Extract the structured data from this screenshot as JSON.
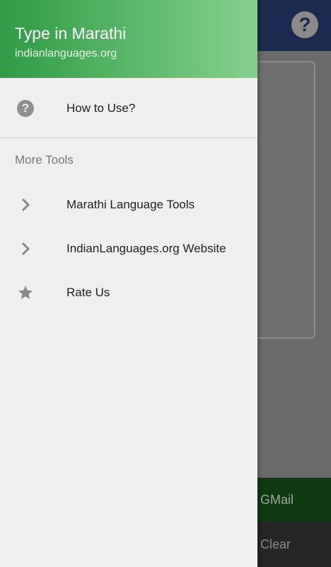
{
  "drawer": {
    "title": "Type in Marathi",
    "subtitle": "indianlanguages.org",
    "items": [
      {
        "label": "How to Use?",
        "icon": "help-icon"
      }
    ],
    "section_header": "More Tools",
    "tools": [
      {
        "label": "Marathi Language Tools",
        "icon": "chevron-right-icon"
      },
      {
        "label": "IndianLanguages.org Website",
        "icon": "chevron-right-icon"
      },
      {
        "label": "Rate Us",
        "icon": "star-icon"
      }
    ]
  },
  "background": {
    "help_glyph": "?",
    "gmail_label": "GMail",
    "clear_label": "Clear"
  },
  "colors": {
    "header_start": "#2f9a45",
    "header_end": "#86cf8e",
    "toolbar": "#1d2a4f",
    "gmail_button": "#0f3a12"
  }
}
